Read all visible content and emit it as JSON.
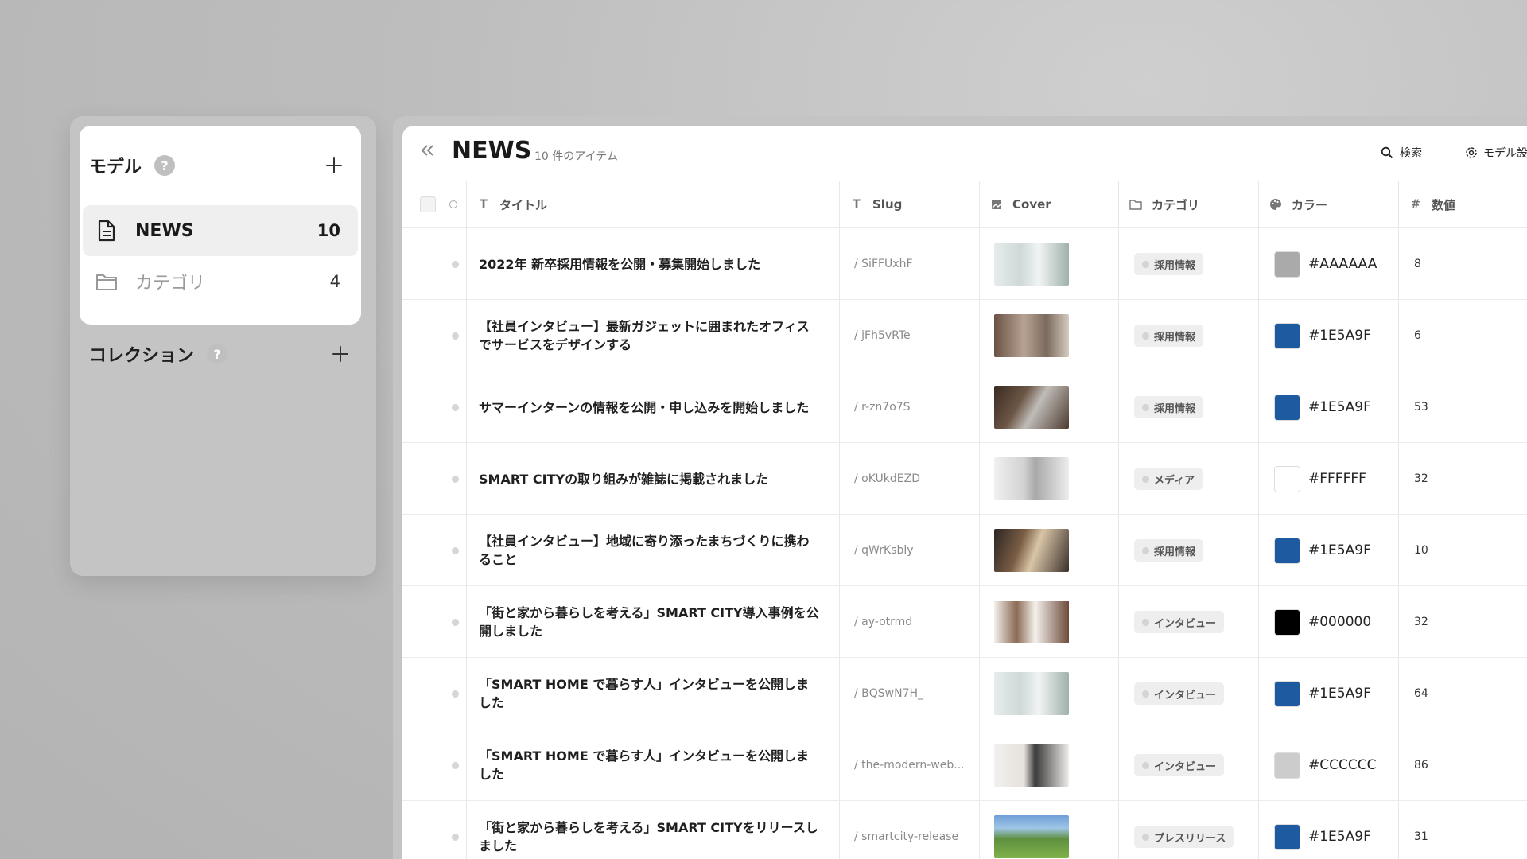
{
  "sidebar": {
    "models_title": "モデル",
    "help_mark": "?",
    "items": [
      {
        "label": "NEWS",
        "count": "10"
      },
      {
        "label": "カテゴリ",
        "count": "4"
      }
    ],
    "collections_title": "コレクション"
  },
  "header": {
    "title": "NEWS",
    "count_text": "10 件のアイテム",
    "search_label": "検索",
    "settings_label": "モデル設"
  },
  "columns": {
    "title": "タイトル",
    "slug": "Slug",
    "cover": "Cover",
    "category": "カテゴリ",
    "color": "カラー",
    "number": "数値"
  },
  "colors": {
    "thumb_palettes": [
      "linear-gradient(90deg,#e6ecec 0%,#cfd8d8 35%,#f1f4f4 60%,#9fb0ab 100%)",
      "linear-gradient(90deg,#6b5143 0%,#b7a394 40%,#7b6a5c 70%,#d5ccc1 100%)",
      "linear-gradient(120deg,#3a2a22 0%,#6c5646 35%,#bfbcb8 55%,#4e3b2f 100%)",
      "linear-gradient(90deg,#f0f0f0 0%,#d2d2d2 40%,#a8a8a8 55%,#ededed 100%)",
      "linear-gradient(110deg,#2c2523 0%,#7a5d44 35%,#d9c6a7 55%,#3b2f2a 100%)",
      "linear-gradient(90deg,#f2efeb 0%,#8b6a55 30%,#f4f1ec 55%,#6d4a3a 100%)",
      "linear-gradient(90deg,#e6ecec 0%,#cfd8d8 35%,#f1f4f4 60%,#9fb0ab 100%)",
      "linear-gradient(90deg,#f2f0ee 0%,#e5e1dc 40%,#3a3a3a 55%,#f0eeeb 100%)",
      "linear-gradient(180deg,#6f9fd8 0%,#9fc6e6 30%,#5e8f3e 55%,#7fb24b 100%)"
    ]
  },
  "rows": [
    {
      "title": "2022年 新卒採用情報を公開・募集開始しました",
      "slug": "/ SiFFUxhF",
      "category": "採用情報",
      "hex": "#AAAAAA",
      "number": "8"
    },
    {
      "title": "【社員インタビュー】最新ガジェットに囲まれたオフィスでサービスをデザインする",
      "slug": "/ jFh5vRTe",
      "category": "採用情報",
      "hex": "#1E5A9F",
      "number": "6"
    },
    {
      "title": "サマーインターンの情報を公開・申し込みを開始しました",
      "slug": "/ r-zn7o7S",
      "category": "採用情報",
      "hex": "#1E5A9F",
      "number": "53"
    },
    {
      "title": "SMART CITYの取り組みが雑誌に掲載されました",
      "slug": "/ oKUkdEZD",
      "category": "メディア",
      "hex": "#FFFFFF",
      "number": "32"
    },
    {
      "title": "【社員インタビュー】地域に寄り添ったまちづくりに携わること",
      "slug": "/ qWrKsbly",
      "category": "採用情報",
      "hex": "#1E5A9F",
      "number": "10"
    },
    {
      "title": "「街と家から暮らしを考える」SMART CITY導入事例を公開しました",
      "slug": "/ ay-otrmd",
      "category": "インタビュー",
      "hex": "#000000",
      "number": "32"
    },
    {
      "title": "「SMART HOME で暮らす人」インタビューを公開しました",
      "slug": "/ BQSwN7H_",
      "category": "インタビュー",
      "hex": "#1E5A9F",
      "number": "64"
    },
    {
      "title": "「SMART HOME で暮らす人」インタビューを公開しました",
      "slug": "/ the-modern-web...",
      "category": "インタビュー",
      "hex": "#CCCCCC",
      "number": "86"
    },
    {
      "title": "「街と家から暮らしを考える」SMART CITYをリリースしました",
      "slug": "/ smartcity-release",
      "category": "プレスリリース",
      "hex": "#1E5A9F",
      "number": "31"
    }
  ]
}
